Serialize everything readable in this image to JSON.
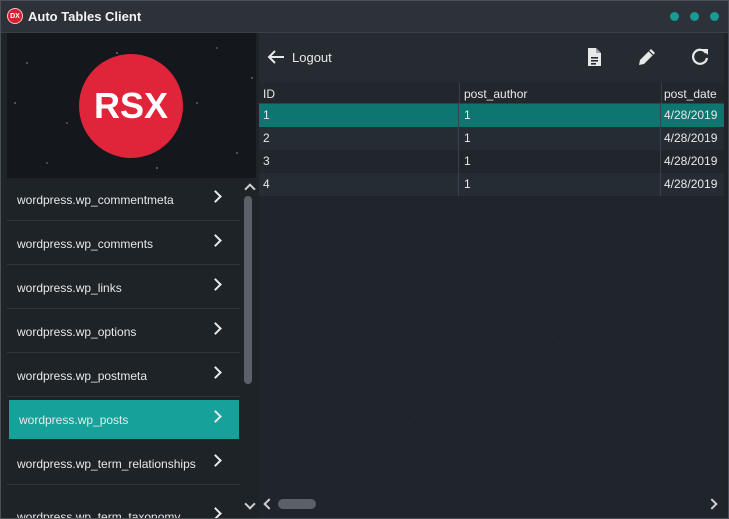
{
  "window": {
    "title": "Auto Tables Client",
    "app_icon_text": "DX",
    "accent": "#179b96"
  },
  "logo": {
    "text": "RSX",
    "color": "#e0243a"
  },
  "sidebar": {
    "items": [
      {
        "label": "wordpress.wp_commentmeta",
        "active": false
      },
      {
        "label": "wordpress.wp_comments",
        "active": false
      },
      {
        "label": "wordpress.wp_links",
        "active": false
      },
      {
        "label": "wordpress.wp_options",
        "active": false
      },
      {
        "label": "wordpress.wp_postmeta",
        "active": false
      },
      {
        "label": "wordpress.wp_posts",
        "active": true
      },
      {
        "label": "wordpress.wp_term_relationships",
        "active": false
      },
      {
        "label": "wordpress.wp_term_taxonomy",
        "active": false
      }
    ]
  },
  "toolbar": {
    "logout_label": "Logout",
    "icons": [
      "arrow-left-icon",
      "document-icon",
      "pencil-icon",
      "refresh-icon"
    ]
  },
  "table": {
    "columns": [
      "ID",
      "post_author",
      "post_date"
    ],
    "rows": [
      [
        "1",
        "1",
        "4/28/2019"
      ],
      [
        "2",
        "1",
        "4/28/2019"
      ],
      [
        "3",
        "1",
        "4/28/2019"
      ],
      [
        "4",
        "1",
        "4/28/2019"
      ]
    ],
    "selected_row": 0
  }
}
